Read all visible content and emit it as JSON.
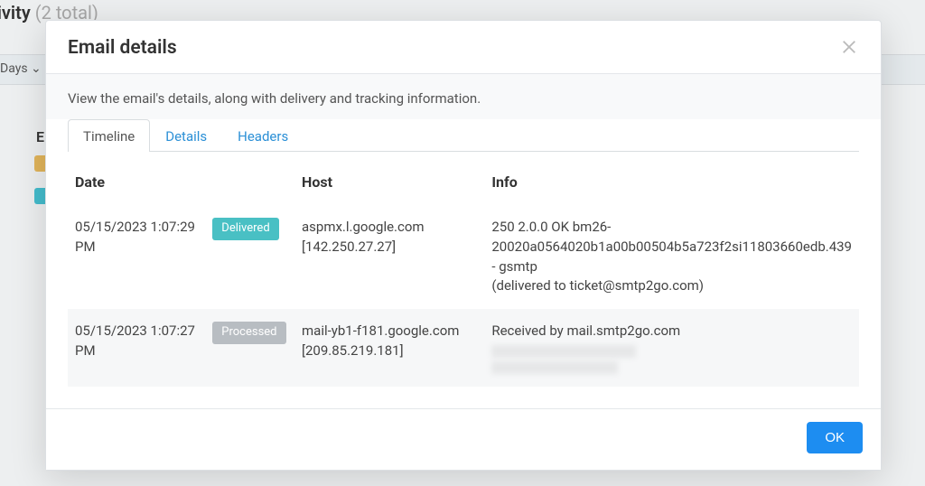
{
  "background": {
    "page_title_prefix": "tivity",
    "page_title_count": "(2 total)",
    "filter_label": "Days",
    "list_header_letter": "E"
  },
  "modal": {
    "title": "Email details",
    "subtitle": "View the email's details, along with delivery and tracking information.",
    "tabs": [
      {
        "label": "Timeline",
        "active": true
      },
      {
        "label": "Details",
        "active": false
      },
      {
        "label": "Headers",
        "active": false
      }
    ],
    "table": {
      "columns": {
        "date": "Date",
        "host": "Host",
        "info": "Info"
      },
      "rows": [
        {
          "date": "05/15/2023 1:07:29 PM",
          "status_label": "Delivered",
          "status_kind": "delivered",
          "host": "aspmx.l.google.com [142.250.27.27]",
          "info": "250 2.0.0 OK bm26-20020a0564020b1a00b00504b5a723f2si11803660edb.439 - gsmtp\n(delivered to ticket@smtp2go.com)"
        },
        {
          "date": "05/15/2023 1:07:27 PM",
          "status_label": "Processed",
          "status_kind": "processed",
          "host": "mail-yb1-f181.google.com [209.85.219.181]",
          "info": "Received by mail.smtp2go.com"
        }
      ]
    },
    "ok_button": "OK"
  }
}
